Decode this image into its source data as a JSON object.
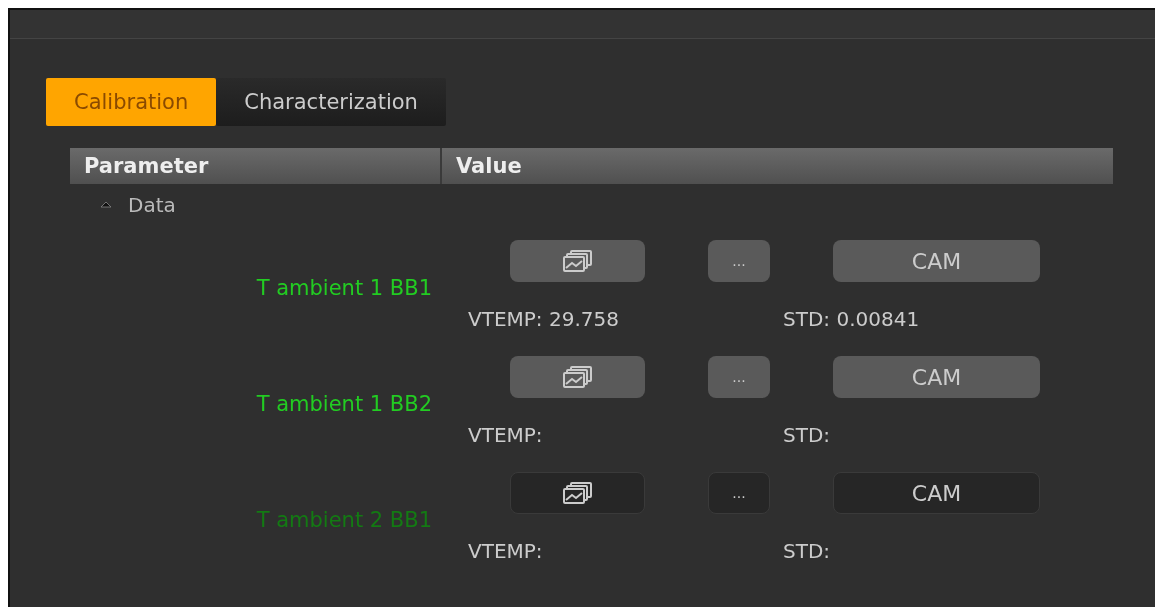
{
  "tabs": [
    {
      "label": "Calibration",
      "selected": true
    },
    {
      "label": "Characterization",
      "selected": false
    }
  ],
  "table": {
    "columns": [
      "Parameter",
      "Value"
    ],
    "group": {
      "label": "Data",
      "expanded": true
    },
    "rows": [
      {
        "name": "T ambient 1 BB1",
        "disabled": false,
        "dots": "...",
        "cam": "CAM",
        "vtemp": "VTEMP: 29.758",
        "std": "STD: 0.00841"
      },
      {
        "name": "T ambient 1 BB2",
        "disabled": false,
        "dots": "...",
        "cam": "CAM",
        "vtemp": "VTEMP:",
        "std": "STD:"
      },
      {
        "name": "T ambient 2 BB1",
        "disabled": true,
        "dots": "...",
        "cam": "CAM",
        "vtemp": "VTEMP:",
        "std": "STD:"
      }
    ]
  }
}
